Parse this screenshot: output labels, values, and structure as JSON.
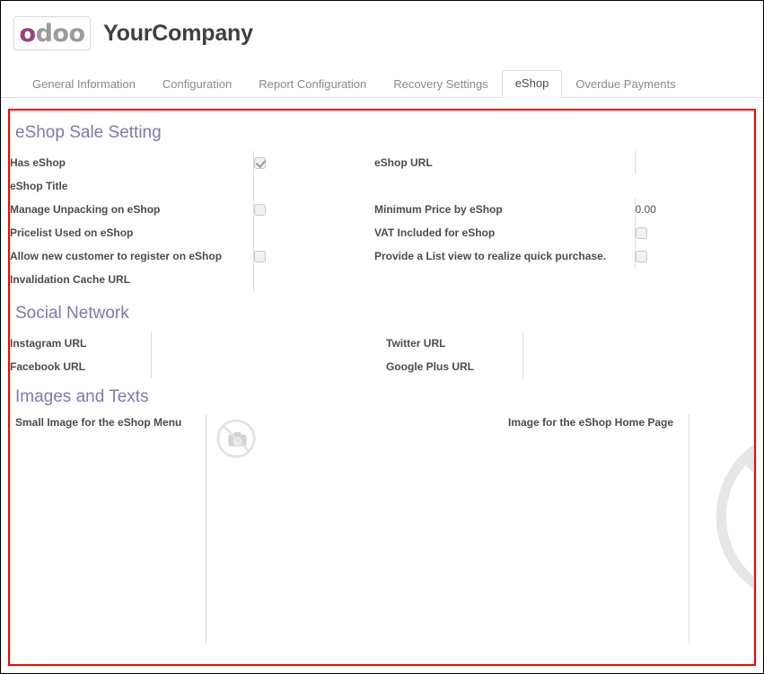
{
  "brand": {
    "logo_first": "o",
    "logo_rest": "doo",
    "logo_icon": "odoo-logo-icon",
    "company_name": "YourCompany",
    "accent_color": "#7c7bad",
    "logo_purple": "#9b3f7a",
    "logo_gray": "#9b9b9b",
    "highlight_border_color": "#ff0000"
  },
  "tabs": [
    {
      "label": "General Information",
      "active": false
    },
    {
      "label": "Configuration",
      "active": false
    },
    {
      "label": "Report Configuration",
      "active": false
    },
    {
      "label": "Recovery Settings",
      "active": false
    },
    {
      "label": "eShop",
      "active": true
    },
    {
      "label": "Overdue Payments",
      "active": false
    }
  ],
  "groups": {
    "sale_setting": {
      "title": "eShop Sale Setting",
      "rows": [
        {
          "left_label": "Has eShop",
          "left_type": "checkbox",
          "left_value": "checked",
          "right_label": "eShop URL",
          "right_type": "text",
          "right_value": ""
        },
        {
          "left_label": "eShop Title",
          "left_type": "text",
          "left_value": "",
          "right_label": "",
          "right_type": "none",
          "right_value": ""
        },
        {
          "left_label": "Manage Unpacking on eShop",
          "left_type": "checkbox",
          "left_value": "unchecked",
          "right_label": "Minimum Price by eShop",
          "right_type": "number",
          "right_value": "0.00"
        },
        {
          "left_label": "Pricelist Used on eShop",
          "left_type": "text",
          "left_value": "",
          "right_label": "VAT Included for eShop",
          "right_type": "checkbox",
          "right_value": "unchecked"
        },
        {
          "left_label": "Allow new customer to register on eShop",
          "left_type": "checkbox",
          "left_value": "unchecked",
          "right_label": "Provide a List view to realize quick purchase.",
          "right_type": "checkbox",
          "right_value": "unchecked"
        },
        {
          "left_label": "Invalidation Cache URL",
          "left_type": "text",
          "left_value": "",
          "right_label": "",
          "right_type": "none",
          "right_value": ""
        }
      ]
    },
    "social_network": {
      "title": "Social Network",
      "rows": [
        {
          "left_label": "Instagram URL",
          "left_value": "",
          "right_label": "Twitter URL",
          "right_value": ""
        },
        {
          "left_label": "Facebook URL",
          "left_value": "",
          "right_label": "Google Plus URL",
          "right_value": ""
        }
      ]
    },
    "images_and_texts": {
      "title": "Images and Texts",
      "small_image_label": "Small Image for the eShop Menu",
      "small_image_placeholder": "no-image-camera-icon",
      "home_image_label": "Image for the eShop Home Page",
      "home_image_placeholder": "no-image-camera-icon"
    }
  }
}
